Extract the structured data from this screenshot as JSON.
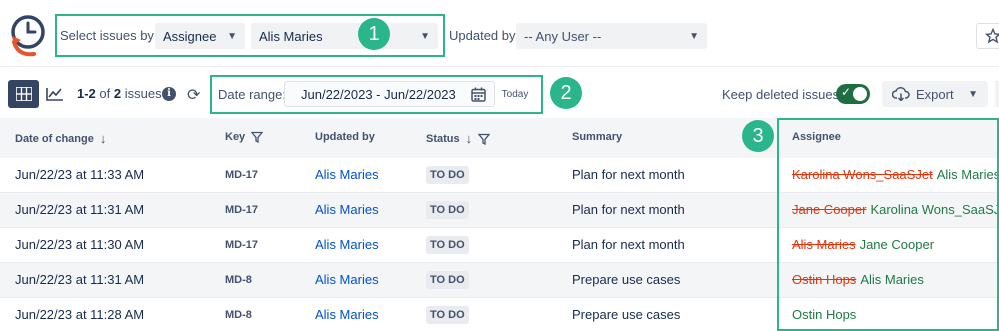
{
  "filters": {
    "select_label": "Select issues by:",
    "select_field": "Assignee",
    "select_value": "Alis Maries",
    "updated_label": "Updated by:",
    "updated_value": "-- Any User --"
  },
  "toolbar": {
    "count_range": "1-2",
    "count_of": "of",
    "count_total": "2",
    "count_suffix": "issues",
    "date_label": "Date range:",
    "date_value": "Jun/22/2023 - Jun/22/2023",
    "today_label": "Today",
    "keep_deleted_label": "Keep deleted issues",
    "export_label": "Export"
  },
  "table": {
    "headers": {
      "date": "Date of change",
      "key": "Key",
      "updated_by": "Updated by",
      "status": "Status",
      "summary": "Summary",
      "assignee": "Assignee"
    },
    "rows": [
      {
        "date": "Jun/22/23 at 11:33 AM",
        "key": "MD-17",
        "user": "Alis Maries",
        "status": "TO DO",
        "summary": "Plan for next month",
        "old_assignee": "Karolina Wons_SaaSJet",
        "new_assignee": "Alis Maries"
      },
      {
        "date": "Jun/22/23 at 11:31 AM",
        "key": "MD-17",
        "user": "Alis Maries",
        "status": "TO DO",
        "summary": "Plan for next month",
        "old_assignee": "Jane Cooper",
        "new_assignee": "Karolina Wons_SaaSJet"
      },
      {
        "date": "Jun/22/23 at 11:30 AM",
        "key": "MD-17",
        "user": "Alis Maries",
        "status": "TO DO",
        "summary": "Plan for next month",
        "old_assignee": "Alis Maries",
        "new_assignee": "Jane Cooper"
      },
      {
        "date": "Jun/22/23 at 11:31 AM",
        "key": "MD-8",
        "user": "Alis Maries",
        "status": "TO DO",
        "summary": "Prepare use cases",
        "old_assignee": "Ostin Hops",
        "new_assignee": "Alis Maries"
      },
      {
        "date": "Jun/22/23 at 11:28 AM",
        "key": "MD-8",
        "user": "Alis Maries",
        "status": "TO DO",
        "summary": "Prepare use cases",
        "old_assignee": "",
        "new_assignee": "Ostin Hops"
      }
    ]
  },
  "annotations": {
    "badge_1": "1",
    "badge_2": "2",
    "badge_3": "3"
  },
  "colors": {
    "annotation": "#2ab58a",
    "removed": "#de350b",
    "added": "#1f7a45",
    "link": "#0052cc",
    "toggle_on": "#1f6e43"
  },
  "icons": [
    "app-logo-icon",
    "chevron-down-icon",
    "star-icon",
    "grid-view-icon",
    "chart-view-icon",
    "info-icon",
    "refresh-icon",
    "calendar-icon",
    "check-icon",
    "export-cloud-icon",
    "sort-down-icon",
    "filter-icon"
  ]
}
